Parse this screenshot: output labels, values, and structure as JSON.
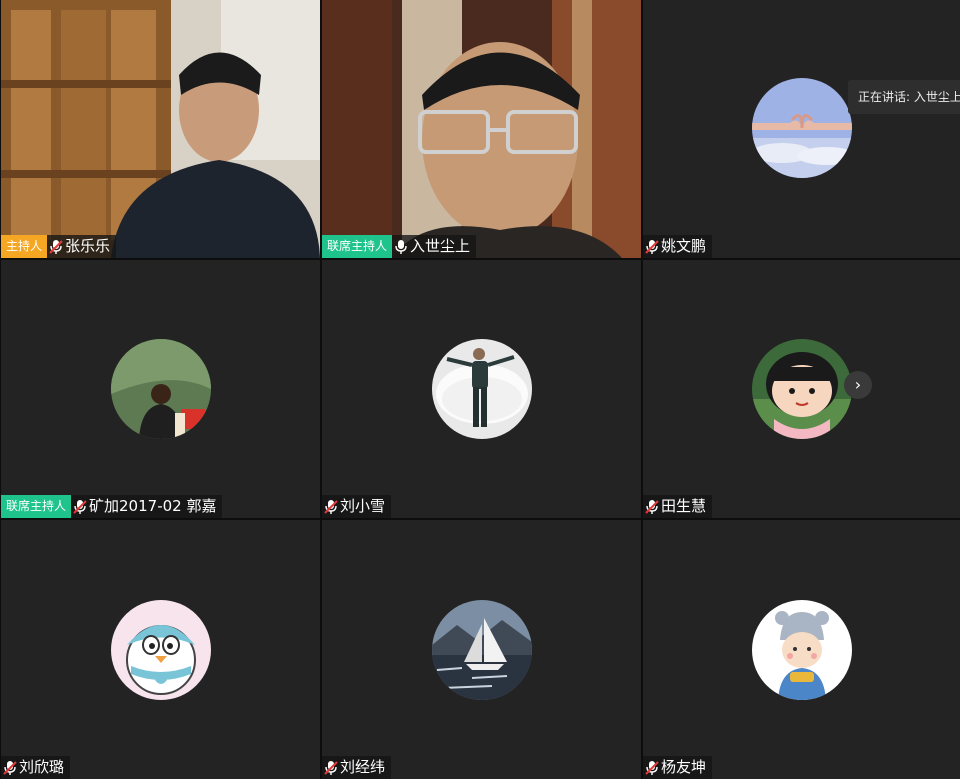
{
  "speaking_banner": "正在讲话: 入世尘上",
  "page_next_glyph": "›",
  "colors": {
    "host": "#f5a623",
    "cohost": "#1ec48b",
    "tile": "#232323",
    "muted_icon": "#e23a3a"
  },
  "participants": [
    {
      "name": "张乐乐",
      "role": "主持人",
      "mic": "muted",
      "media": "video"
    },
    {
      "name": "入世尘上",
      "role": "联席主持人",
      "mic": "on",
      "media": "video"
    },
    {
      "name": "姚文鹏",
      "role": "",
      "mic": "muted",
      "media": "avatar",
      "avatar_icon": "heart-hands-sky-icon"
    },
    {
      "name": "矿加2017-02 郭嘉",
      "role": "联席主持人",
      "mic": "muted",
      "media": "avatar",
      "avatar_icon": "april-poster-icon"
    },
    {
      "name": "刘小雪",
      "role": "",
      "mic": "muted",
      "media": "avatar",
      "avatar_icon": "person-on-pillow-icon"
    },
    {
      "name": "田生慧",
      "role": "",
      "mic": "muted",
      "media": "avatar",
      "avatar_icon": "cartoon-girl-icon"
    },
    {
      "name": "刘欣璐",
      "role": "",
      "mic": "muted",
      "media": "avatar",
      "avatar_icon": "cartoon-bird-icon"
    },
    {
      "name": "刘经纬",
      "role": "",
      "mic": "muted",
      "media": "avatar",
      "avatar_icon": "sailboat-icon"
    },
    {
      "name": "杨友坤",
      "role": "",
      "mic": "muted",
      "media": "avatar",
      "avatar_icon": "cartoon-kid-icon"
    }
  ]
}
